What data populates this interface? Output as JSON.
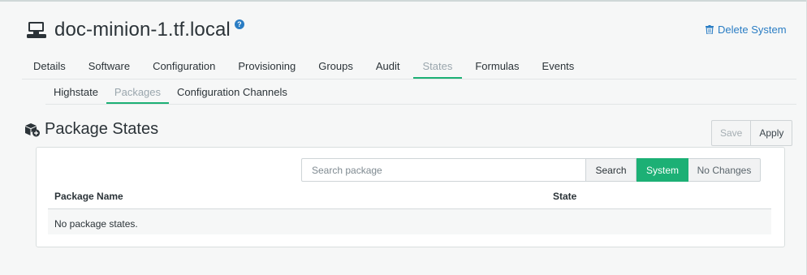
{
  "system": {
    "title": "doc-minion-1.tf.local",
    "help_icon": "question-circle-icon",
    "delete_label": "Delete System",
    "icon": "desktop-icon"
  },
  "tabs": [
    {
      "label": "Details",
      "active": false
    },
    {
      "label": "Software",
      "active": false
    },
    {
      "label": "Configuration",
      "active": false
    },
    {
      "label": "Provisioning",
      "active": false
    },
    {
      "label": "Groups",
      "active": false
    },
    {
      "label": "Audit",
      "active": false
    },
    {
      "label": "States",
      "active": true
    },
    {
      "label": "Formulas",
      "active": false
    },
    {
      "label": "Events",
      "active": false
    }
  ],
  "subtabs": [
    {
      "label": "Highstate",
      "active": false
    },
    {
      "label": "Packages",
      "active": true
    },
    {
      "label": "Configuration Channels",
      "active": false
    }
  ],
  "section": {
    "title": "Package States",
    "save_label": "Save",
    "apply_label": "Apply"
  },
  "search": {
    "placeholder": "Search package",
    "search_label": "Search",
    "system_label": "System",
    "no_changes_label": "No Changes"
  },
  "table": {
    "columns": [
      "Package Name",
      "State"
    ],
    "empty_message": "No package states."
  },
  "colors": {
    "accent": "#1cb075",
    "link": "#2a7dc4"
  }
}
